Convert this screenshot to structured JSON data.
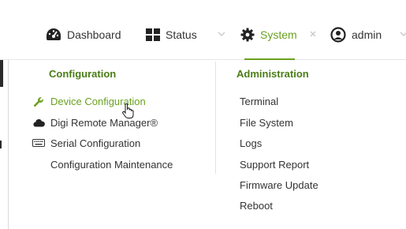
{
  "topnav": {
    "items": [
      {
        "label": "Dashboard",
        "icon": "dashboard-gauge-icon"
      },
      {
        "label": "Status",
        "icon": "grid-icon"
      },
      {
        "label": "System",
        "icon": "gear-icon",
        "active": true
      },
      {
        "label": "admin",
        "icon": "user-circle-icon"
      }
    ]
  },
  "menu": {
    "configuration": {
      "heading": "Configuration",
      "items": [
        {
          "label": "Device Configuration",
          "icon": "wrench-icon",
          "active": true
        },
        {
          "label": "Digi Remote Manager®",
          "icon": "cloud-icon"
        },
        {
          "label": "Serial Configuration",
          "icon": "keyboard-icon"
        },
        {
          "label": "Configuration Maintenance",
          "icon": ""
        }
      ]
    },
    "administration": {
      "heading": "Administration",
      "items": [
        {
          "label": "Terminal"
        },
        {
          "label": "File System"
        },
        {
          "label": "Logs"
        },
        {
          "label": "Support Report"
        },
        {
          "label": "Firmware Update"
        },
        {
          "label": "Reboot"
        }
      ]
    }
  },
  "colors": {
    "accent": "#6aa121",
    "heading": "#4a7d16",
    "text": "#333333"
  }
}
